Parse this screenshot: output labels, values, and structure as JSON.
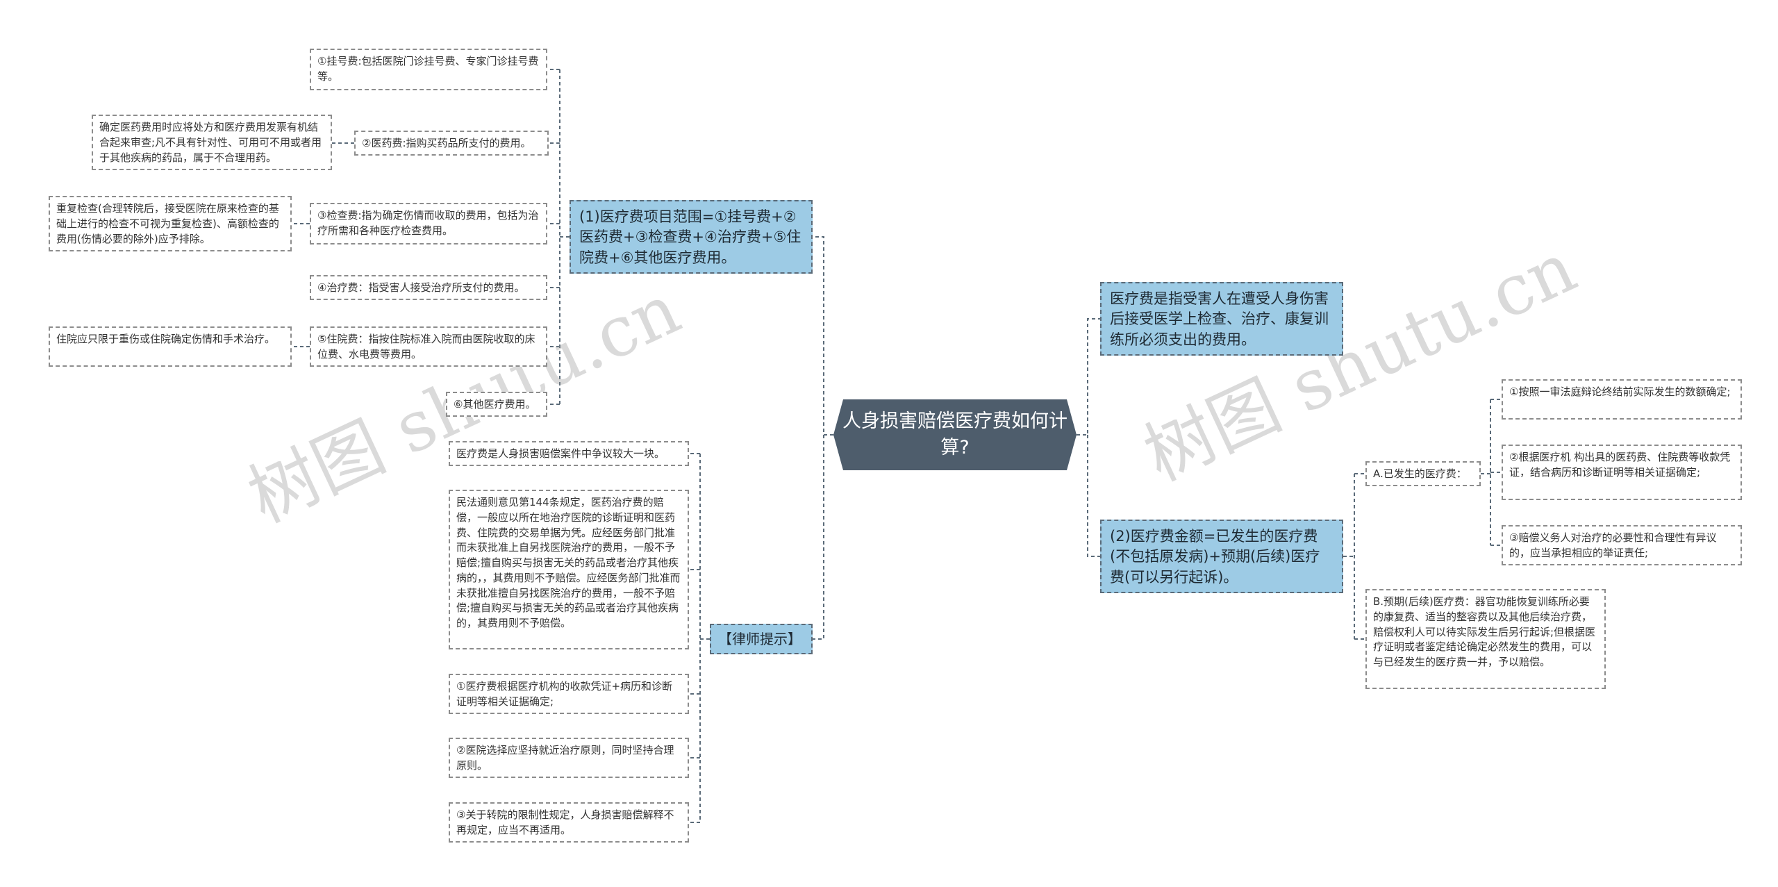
{
  "root": "人身损害赔偿医疗费如何计算?",
  "watermark": "树图 shutu.cn",
  "branches": {
    "scope": "(1)医疗费项目范围=①挂号费+②医药费+③检查费+④治疗费+⑤住院费+⑥其他医疗费用。",
    "lawyer": "【律师提示】",
    "definition": "医疗费是指受害人在遭受人身伤害后接受医学上检查、治疗、康复训练所必须支出的费用。",
    "amount": "(2)医疗费金额=已发生的医疗费(不包括原发病)+预期(后续)医疗费(可以另行起诉)。"
  },
  "scope_items": [
    "①挂号费:包括医院门诊挂号费、专家门诊挂号费等。",
    "②医药费:指购买药品所支付的费用。",
    "③检查费:指为确定伤情而收取的费用，包括为治疗所需和各种医疗检查费用。",
    "④治疗费：指受害人接受治疗所支付的费用。",
    "⑤住院费：指按住院标准入院而由医院收取的床位费、水电费等费用。",
    "⑥其他医疗费用。"
  ],
  "scope_notes": {
    "medicine": "确定医药费用时应将处方和医疗费用发票有机结合起来审查;凡不具有针对性、可用可不用或者用于其他疾病的药品，属于不合理用药。",
    "exam": "重复检查(合理转院后，接受医院在原来检查的基础上进行的检查不可视为重复检查)、高额检查的费用(伤情必要的除外)应予排除。",
    "hospital": "住院应只限于重伤或住院确定伤情和手术治疗。"
  },
  "lawyer_items": [
    "医疗费是人身损害赔偿案件中争议较大一块。",
    "民法通则意见第144条规定，医药治疗费的赔偿，一般应以所在地治疗医院的诊断证明和医药费、住院费的交易单据为凭。应经医务部门批准而未获批准上自另找医院治疗的费用，一般不予赔偿;擅自购买与损害无关的药品或者治疗其他疾病的，，其费用则不予赔偿。应经医务部门批准而未获批准擅自另找医院治疗的费用，一般不予赔偿;擅自购买与损害无关的药品或者治疗其他疾病的，其费用则不予赔偿。",
    "①医疗费根据医疗机构的收款凭证+病历和诊断证明等相关证据确定;",
    "②医院选择应坚持就近治疗原则，同时坚持合理原则。",
    "③关于转院的限制性规定，人身损害赔偿解释不再规定，应当不再适用。"
  ],
  "amount_items": {
    "occurred": "A.已发生的医疗费：",
    "expected": "B.预期(后续)医疗费：器官功能恢复训练所必要的康复费、适当的整容费以及其他后续治疗费，赔偿权利人可以待实际发生后另行起诉;但根据医疗证明或者鉴定结论确定必然发生的费用，可以与已经发生的医疗费一并，予以赔偿。"
  },
  "occurred_items": [
    "①按照一审法庭辩论终结前实际发生的数额确定;",
    "②根据医疗机 构出具的医药费、住院费等收款凭证，结合病历和诊断证明等相关证据确定;",
    "③赔偿义务人对治疗的必要性和合理性有异议的，应当承担相应的举证责任;"
  ],
  "colors": {
    "root": "#4e5d6c",
    "branch": "#9dcbe5",
    "line": "#5a6a78"
  }
}
